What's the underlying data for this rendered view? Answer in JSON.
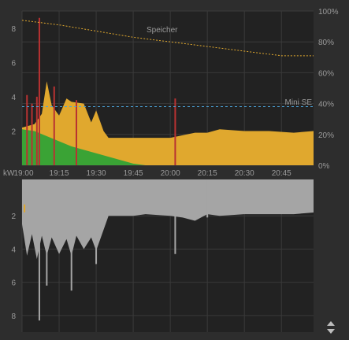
{
  "chart_data": [
    {
      "type": "area",
      "title": "",
      "ylabel": "kW",
      "ylim": [
        0,
        9
      ],
      "yticks": [
        "2",
        "4",
        "6",
        "8"
      ],
      "y2lim": [
        0,
        100
      ],
      "y2ticks": [
        "0%",
        "20%",
        "40%",
        "60%",
        "80%",
        "100%"
      ],
      "xticks": [
        "19:00",
        "19:15",
        "19:30",
        "19:45",
        "20:00",
        "20:15",
        "20:30",
        "20:45"
      ],
      "grid": true,
      "annotations": [
        {
          "label": "Speicher",
          "color": "#e0a82e"
        },
        {
          "label": "Mini SE",
          "color": "#4aa3d8"
        }
      ],
      "series": [
        {
          "name": "Speicher",
          "type": "line",
          "axis": "right",
          "color": "#e0a82e",
          "x": [
            "19:00",
            "19:15",
            "19:30",
            "19:45",
            "20:00",
            "20:15",
            "20:30",
            "20:45",
            "20:58"
          ],
          "values": [
            94,
            91,
            87,
            83,
            80,
            77,
            74,
            71,
            71
          ]
        },
        {
          "name": "Mini SE",
          "type": "line",
          "axis": "right",
          "color": "#4aa3d8",
          "x": [
            "19:00",
            "20:58"
          ],
          "values": [
            38,
            38
          ]
        },
        {
          "color": "#3aa335",
          "x": [
            "19:00",
            "19:05",
            "19:10",
            "19:15",
            "19:20",
            "19:25",
            "19:30",
            "19:35",
            "19:40",
            "19:45",
            "19:50"
          ],
          "values": [
            2.1,
            2.0,
            1.7,
            1.4,
            1.1,
            0.9,
            0.7,
            0.5,
            0.3,
            0.1,
            0.0
          ]
        },
        {
          "color": "#e0a82e",
          "x": [
            "19:00",
            "19:05",
            "19:08",
            "19:10",
            "19:12",
            "19:15",
            "19:18",
            "19:20",
            "19:25",
            "19:28",
            "19:30",
            "19:33",
            "19:35",
            "19:40",
            "19:45",
            "19:50",
            "20:00",
            "20:10",
            "20:15",
            "20:20",
            "20:30",
            "20:40",
            "20:50",
            "20:58"
          ],
          "values": [
            2.2,
            2.4,
            3.0,
            4.9,
            3.5,
            2.9,
            3.9,
            3.7,
            3.6,
            2.5,
            3.2,
            2.0,
            1.6,
            1.6,
            1.6,
            1.6,
            1.6,
            1.9,
            1.9,
            2.1,
            2.0,
            2.0,
            1.9,
            2.0
          ]
        },
        {
          "color": "#b83232",
          "x": [
            "19:02",
            "19:04",
            "19:06",
            "19:07",
            "19:13",
            "19:22",
            "20:02"
          ],
          "values": [
            4.1,
            3.6,
            4.0,
            8.6,
            4.6,
            3.8,
            3.9
          ]
        }
      ]
    },
    {
      "type": "area",
      "title": "",
      "ylim": [
        0,
        9
      ],
      "yticks": [
        "2",
        "4",
        "6",
        "8"
      ],
      "grid": true,
      "series": [
        {
          "color": "#a5a5a5",
          "x": [
            "19:00",
            "19:02",
            "19:04",
            "19:06",
            "19:08",
            "19:10",
            "19:12",
            "19:15",
            "19:18",
            "19:20",
            "19:22",
            "19:25",
            "19:28",
            "19:30",
            "19:35",
            "19:40",
            "19:45",
            "19:50",
            "20:00",
            "20:05",
            "20:10",
            "20:15",
            "20:20",
            "20:30",
            "20:40",
            "20:50",
            "20:58"
          ],
          "values": [
            2.5,
            4.4,
            3.1,
            4.6,
            3.2,
            4.4,
            3.3,
            4.3,
            3.4,
            4.4,
            3.2,
            4.0,
            3.3,
            4.1,
            2.0,
            2.0,
            2.0,
            1.9,
            2.0,
            2.1,
            2.3,
            1.9,
            2.0,
            1.9,
            1.9,
            1.9,
            1.8
          ]
        },
        {
          "color": "#a5a5a5",
          "x": [
            "19:07",
            "19:10",
            "19:20",
            "19:30",
            "20:02",
            "20:15"
          ],
          "values": [
            8.3,
            6.2,
            6.5,
            4.9,
            4.3,
            2.1
          ]
        },
        {
          "color": "#e0a82e",
          "x": [
            "19:01"
          ],
          "values": [
            1.6
          ]
        }
      ]
    }
  ]
}
